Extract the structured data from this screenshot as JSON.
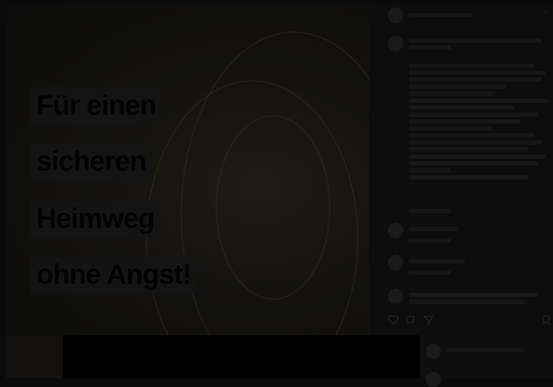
{
  "headline": {
    "lines": [
      "Für einen",
      "sicheren",
      "Heimweg",
      "ohne Angst!"
    ]
  },
  "panel": {
    "close_glyph": "×"
  },
  "colors": {
    "overlay": "#000000",
    "headline_box": "#141414"
  }
}
